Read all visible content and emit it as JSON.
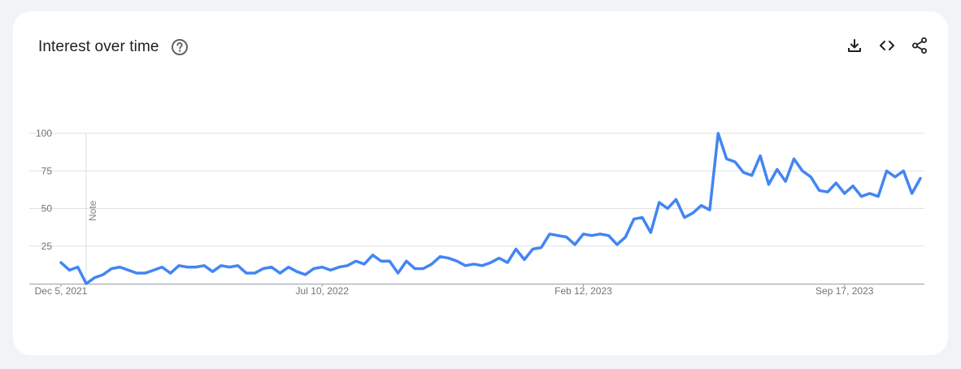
{
  "card": {
    "title": "Interest over time",
    "help_icon": "help-circle-icon",
    "actions": [
      {
        "name": "download-button",
        "icon": "download-icon"
      },
      {
        "name": "embed-button",
        "icon": "code-icon"
      },
      {
        "name": "share-button",
        "icon": "share-icon"
      }
    ]
  },
  "colors": {
    "series": "#4285f4",
    "grid": "#e0e0e0",
    "axis": "#9aa0a6"
  },
  "chart_data": {
    "type": "line",
    "title": "",
    "xlabel": "",
    "ylabel": "",
    "ylim": [
      0,
      100
    ],
    "yticks": [
      25,
      50,
      75,
      100
    ],
    "grid": true,
    "x_tick_labels": [
      "Dec 5, 2021",
      "Jul 10, 2022",
      "Feb 12, 2023",
      "Sep 17, 2023"
    ],
    "x_tick_index": [
      0,
      31,
      62,
      93
    ],
    "annotations": [
      {
        "label": "Note",
        "index": 3
      }
    ],
    "series": [
      {
        "values": [
          14,
          9,
          11,
          0,
          4,
          6,
          10,
          11,
          9,
          7,
          7,
          9,
          11,
          7,
          12,
          11,
          11,
          12,
          8,
          12,
          11,
          12,
          7,
          7,
          10,
          11,
          7,
          11,
          8,
          6,
          10,
          11,
          9,
          11,
          12,
          15,
          13,
          19,
          15,
          15,
          7,
          15,
          10,
          10,
          13,
          18,
          17,
          15,
          12,
          13,
          12,
          14,
          17,
          14,
          23,
          16,
          23,
          24,
          33,
          32,
          31,
          26,
          33,
          32,
          33,
          32,
          26,
          31,
          43,
          44,
          34,
          54,
          50,
          56,
          44,
          47,
          52,
          49,
          100,
          83,
          81,
          74,
          72,
          85,
          66,
          76,
          68,
          83,
          75,
          71,
          62,
          61,
          67,
          60,
          65,
          58,
          60,
          58,
          75,
          71,
          75,
          60,
          70
        ]
      }
    ]
  }
}
